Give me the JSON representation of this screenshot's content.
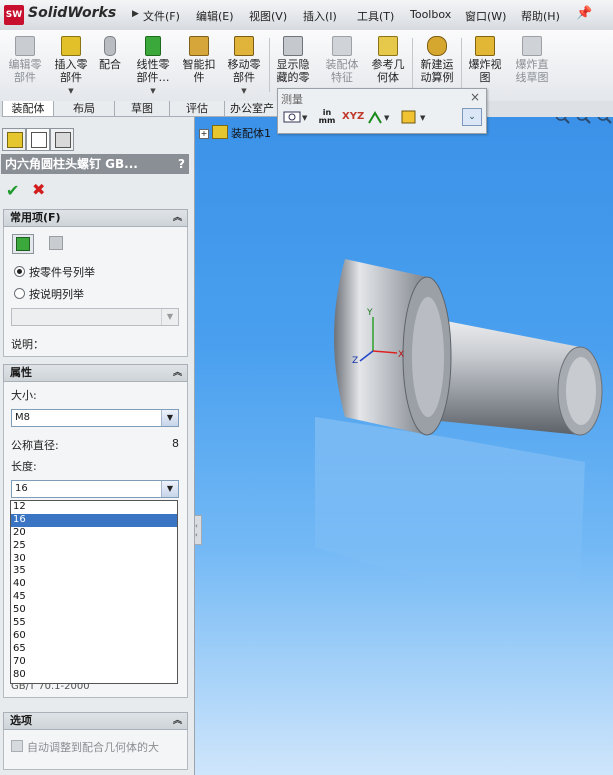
{
  "app": {
    "logo_badge": "SW",
    "logo_text": "SolidWorks"
  },
  "menu": [
    "文件(F)",
    "编辑(E)",
    "视图(V)",
    "插入(I)",
    "工具(T)",
    "Toolbox",
    "窗口(W)",
    "帮助(H)"
  ],
  "ribbon": {
    "edit_part": [
      "编辑零",
      "部件"
    ],
    "insert_part": [
      "插入零",
      "部件"
    ],
    "mate": [
      "配合"
    ],
    "linear_pattern": [
      "线性零",
      "部件…"
    ],
    "smart_fastener": [
      "智能扣",
      "件"
    ],
    "move_part": [
      "移动零",
      "部件"
    ],
    "show_hidden": [
      "显示隐",
      "藏的零"
    ],
    "assembly_feature": [
      "装配体",
      "特征"
    ],
    "reference_geometry": [
      "参考几",
      "何体"
    ],
    "new_motion_study": [
      "新建运",
      "动算例"
    ],
    "explode_view": [
      "爆炸视",
      "图"
    ],
    "explode_line_sketch": [
      "爆炸直",
      "线草图"
    ]
  },
  "tabs": [
    "装配体",
    "布局",
    "草图",
    "评估",
    "办公室产"
  ],
  "measure": {
    "title": "测量",
    "close": "×",
    "units_top": "in",
    "units_bottom": "mm",
    "xyz_label": "XYZ"
  },
  "tree": {
    "expand": "+",
    "root_label": "装配体1"
  },
  "property_manager": {
    "title": "内六角圆柱头螺钉 GB...",
    "help": "?",
    "ok": "✔",
    "cancel": "✖",
    "favorites": {
      "header": "常用项(F)",
      "radio_by_part_number": "按零件号列举",
      "radio_by_description": "按说明列举",
      "description_label": "说明："
    },
    "properties": {
      "header": "属性",
      "size_label": "大小:",
      "size_value": "M8",
      "nominal_diameter_label": "公称直径:",
      "nominal_diameter_value": "8",
      "length_label": "长度:",
      "length_value": "16",
      "length_options": [
        "12",
        "16",
        "20",
        "25",
        "30",
        "35",
        "40",
        "45",
        "50",
        "55",
        "60",
        "65",
        "70",
        "80"
      ],
      "standard_partial": "GB/T 70.1-2000"
    },
    "options": {
      "header": "选项",
      "auto_size_label": "自动调整到配合几何体的大"
    }
  },
  "triad": {
    "x": "X",
    "y": "Y",
    "z": "Z"
  },
  "colors": {
    "accent": "#3a75c4",
    "viewport_top": "#3b92e8",
    "viewport_bottom": "#cfe6fb",
    "ok": "#1d9a2b",
    "cancel": "#d21d1d"
  }
}
